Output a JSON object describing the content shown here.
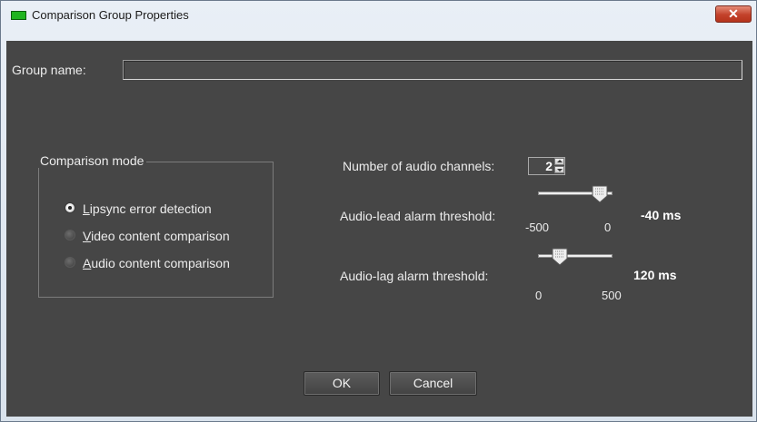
{
  "window": {
    "title": "Comparison Group Properties",
    "close_glyph": "✕"
  },
  "group_name": {
    "label": "Group name:",
    "value": ""
  },
  "comparison_mode": {
    "legend": "Comparison mode",
    "options": [
      {
        "mnemonic": "L",
        "rest": "ipsync error detection",
        "checked": true
      },
      {
        "mnemonic": "V",
        "rest": "ideo content comparison",
        "checked": false
      },
      {
        "mnemonic": "A",
        "rest": "udio content comparison",
        "checked": false
      }
    ]
  },
  "audio_channels": {
    "label": "Number of audio channels:",
    "value": "2"
  },
  "audio_lead": {
    "label": "Audio-lead alarm threshold:",
    "min_label": "-500",
    "max_label": "0",
    "value_label": "-40 ms",
    "min": -500,
    "max": 0,
    "value": -40
  },
  "audio_lag": {
    "label": "Audio-lag alarm threshold:",
    "min_label": "0",
    "max_label": "500",
    "value_label": "120 ms",
    "min": 0,
    "max": 500,
    "value": 120
  },
  "buttons": {
    "ok": "OK",
    "cancel": "Cancel"
  },
  "colors": {
    "panel_bg": "#464646",
    "title_bar": "#dfe6ee",
    "close_button": "#c3412a",
    "app_icon": "#1fb41f"
  },
  "icons": {
    "app": "green-bar-icon",
    "close": "close-icon"
  }
}
